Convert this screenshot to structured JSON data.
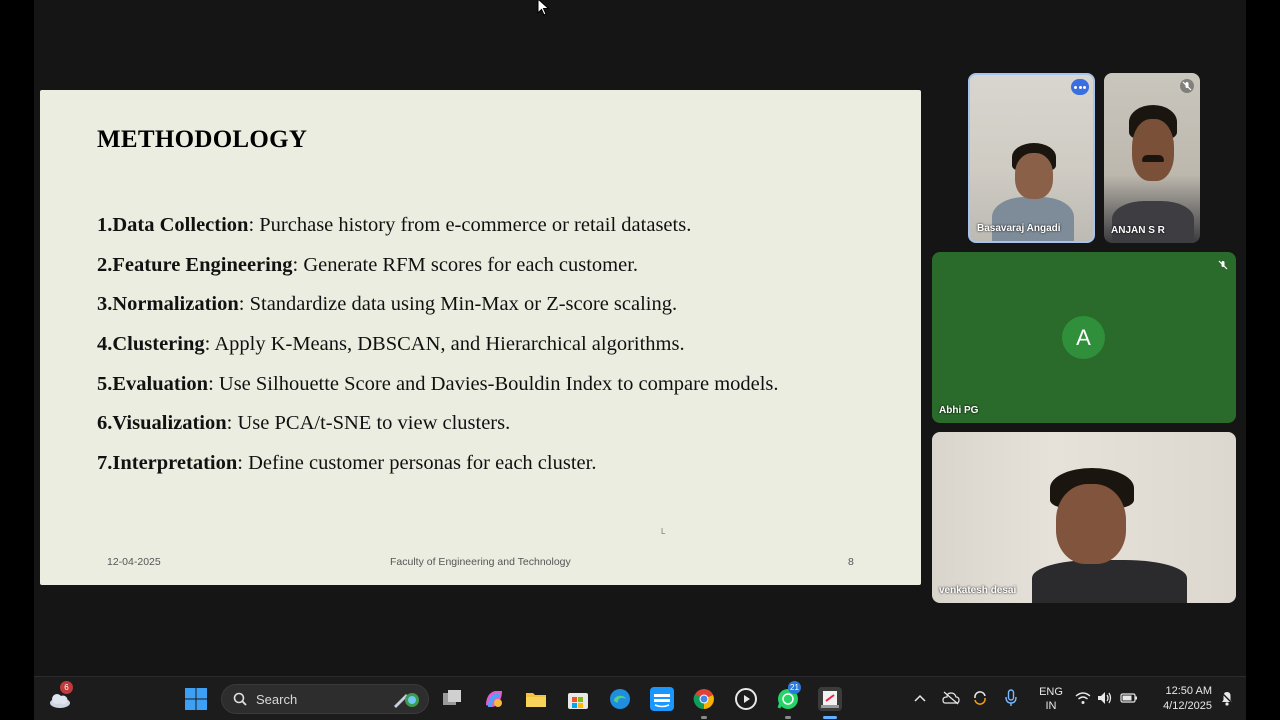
{
  "slide": {
    "title": "METHODOLOGY",
    "items": [
      {
        "term": "1.Data Collection",
        "desc": ": Purchase history from e-commerce or retail datasets."
      },
      {
        "term": "2.Feature Engineering",
        "desc": ": Generate RFM scores for each customer."
      },
      {
        "term": "3.Normalization",
        "desc": ": Standardize data using Min-Max or Z-score scaling."
      },
      {
        "term": "4.Clustering",
        "desc": ": Apply K-Means, DBSCAN, and Hierarchical algorithms."
      },
      {
        "term": "5.Evaluation",
        "desc": ": Use Silhouette Score and Davies-Bouldin Index to compare models."
      },
      {
        "term": "6.Visualization",
        "desc": ": Use PCA/t-SNE to view clusters."
      },
      {
        "term": "7.Interpretation",
        "desc": ": Define customer personas for each cluster."
      }
    ],
    "footer": {
      "date": "12-04-2025",
      "center": "Faculty of Engineering and Technology",
      "page": "8"
    },
    "mark": "L"
  },
  "participants": {
    "basavaraj": {
      "name": "Basavaraj Angadi"
    },
    "anjan": {
      "name": "ANJAN S R"
    },
    "abhi": {
      "name": "Abhi PG",
      "initial": "A"
    },
    "venkatesh": {
      "name": "venkatesh desai"
    }
  },
  "taskbar": {
    "weather_badge": "6",
    "search_label": "Search",
    "whatsapp_badge": "21",
    "lang": "ENG",
    "region": "IN",
    "time": "12:50 AM",
    "date": "4/12/2025"
  },
  "colors": {
    "slide_bg": "#ecede1",
    "tile_green": "#2a6a2a",
    "avatar_green": "#2f8f3a",
    "active_border": "#a8c4ee",
    "taskbar_bg": "#1c1c1c"
  }
}
